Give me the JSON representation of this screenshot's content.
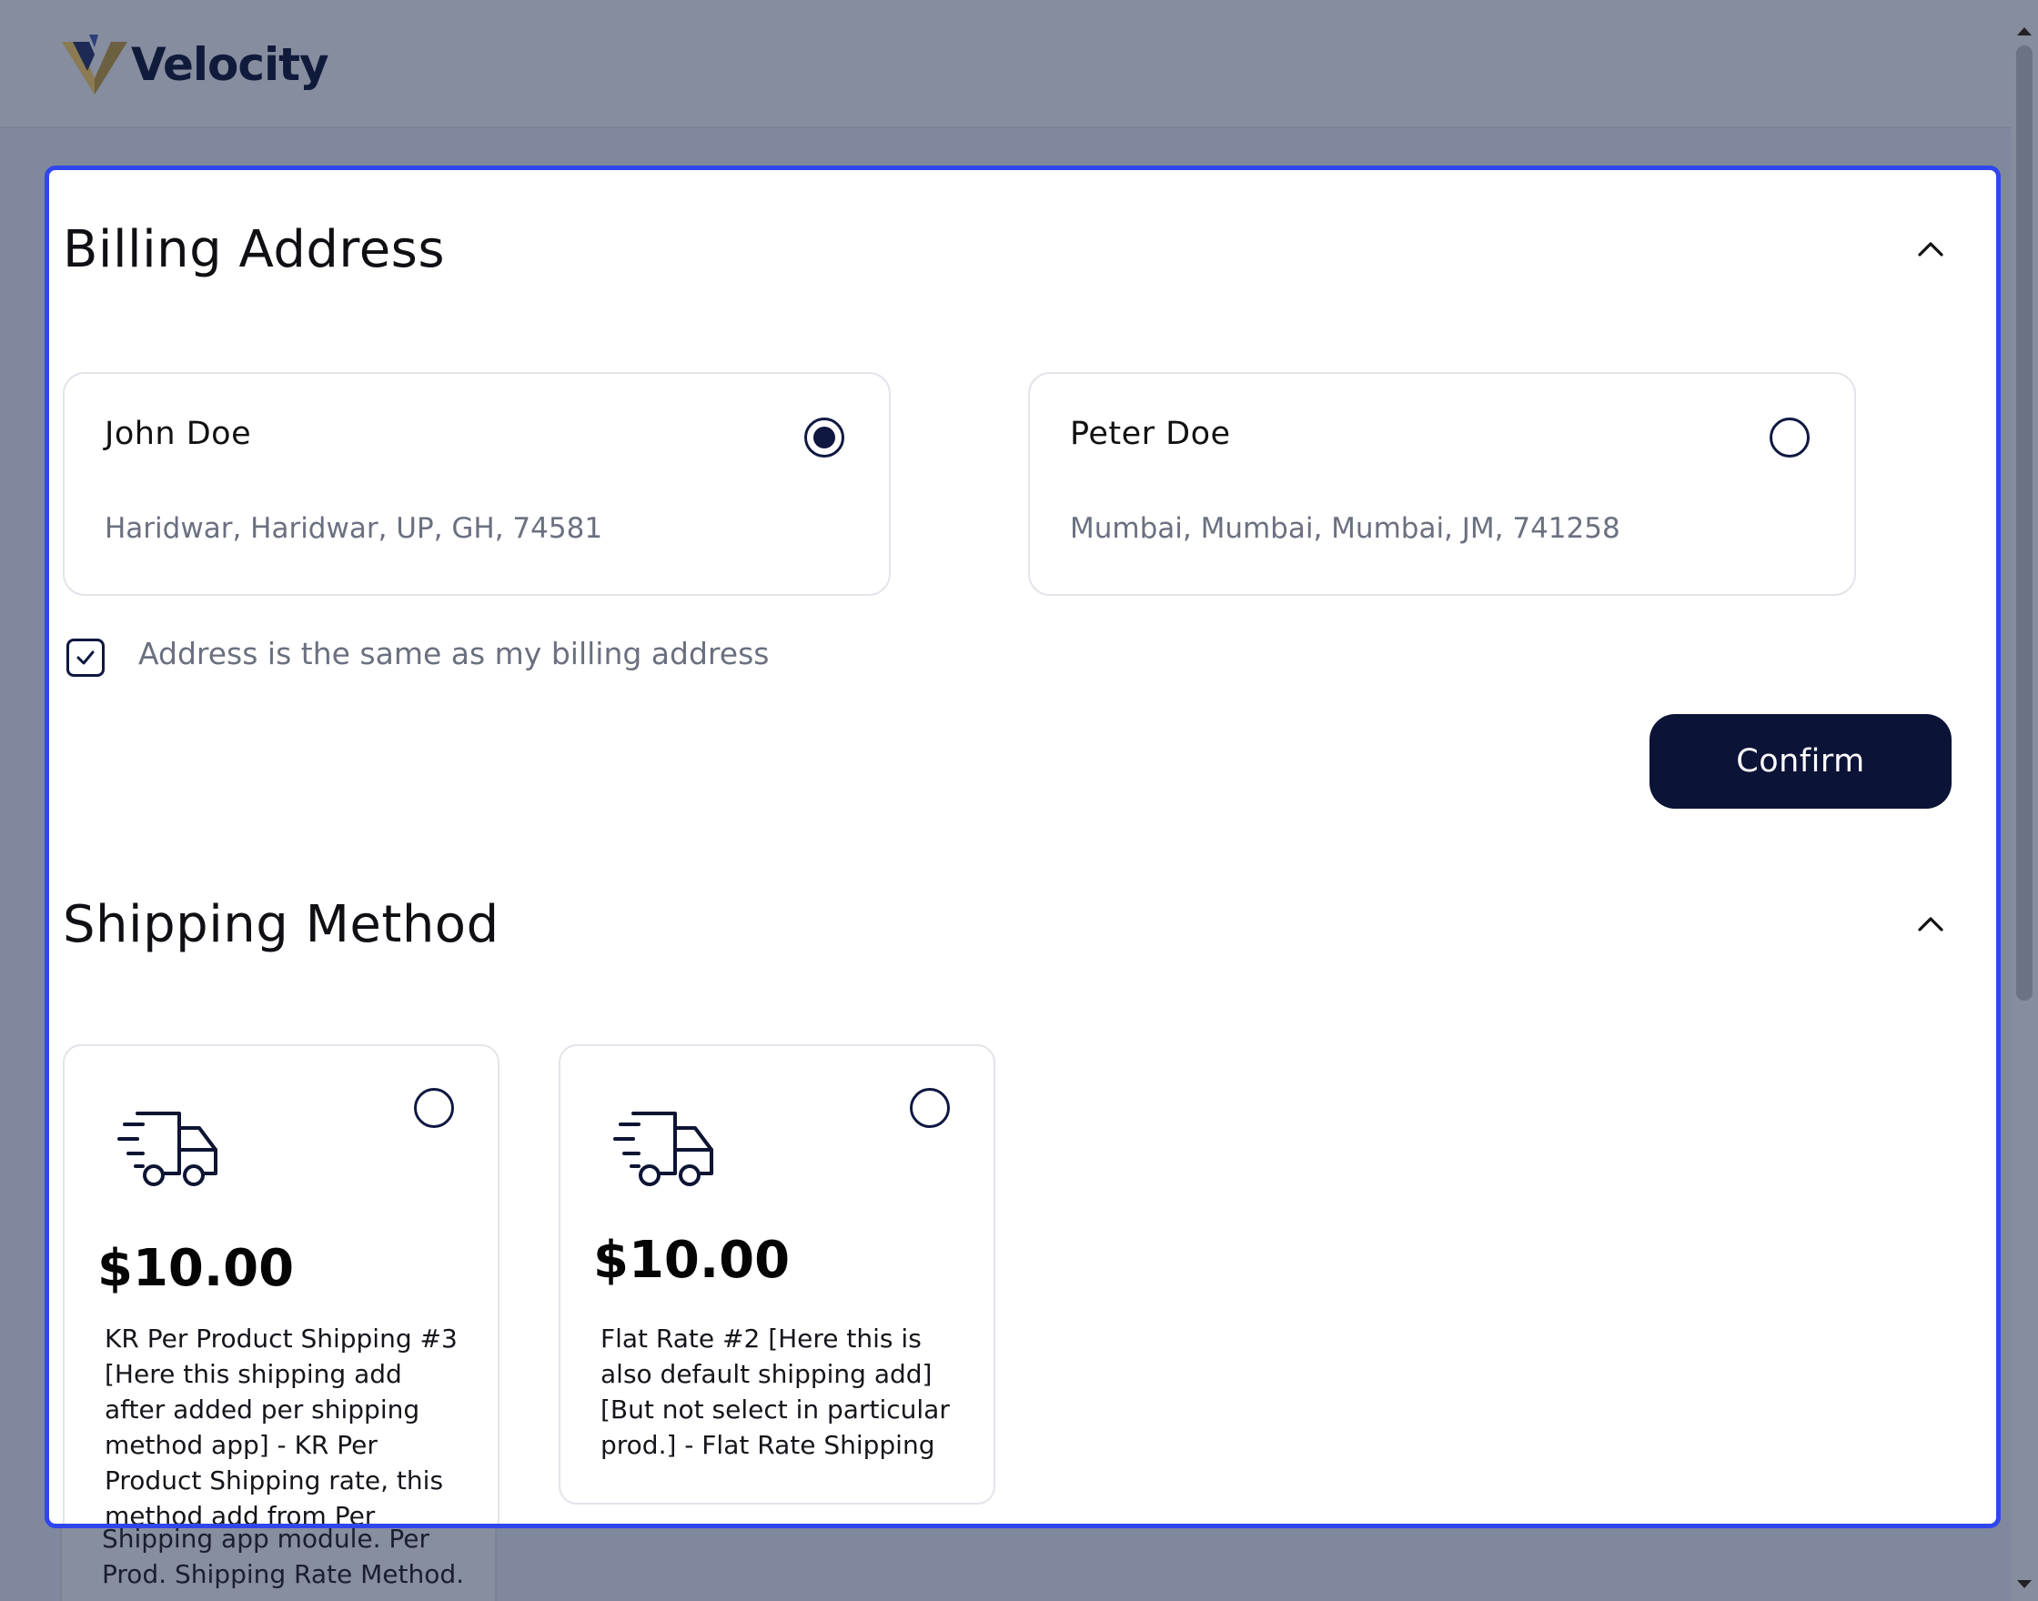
{
  "header": {
    "brand": "Velocity"
  },
  "billing": {
    "title": "Billing Address",
    "addresses": [
      {
        "name": "John Doe",
        "line": "Haridwar, Haridwar, UP, GH, 74581",
        "selected": true
      },
      {
        "name": "Peter Doe",
        "line": "Mumbai, Mumbai, Mumbai, JM, 741258",
        "selected": false
      }
    ],
    "same_address_label": "Address is the same as my billing address",
    "same_address_checked": true,
    "confirm_label": "Confirm"
  },
  "shipping": {
    "title": "Shipping Method",
    "methods": [
      {
        "price": "$10.00",
        "description": "KR Per Product Shipping #3 [Here this shipping add after added per shipping method app] - KR Per Product Shipping rate, this method add from Per Product Shipping app module. Per Prod. Shipping Rate Method.",
        "selected": false
      },
      {
        "price": "$10.00",
        "description": "Flat Rate #2 [Here this is also default shipping add] [But not select in particular prod.] - Flat Rate Shipping",
        "selected": false
      }
    ]
  },
  "colors": {
    "accent": "#2f46ee",
    "primary": "#0b1336",
    "overlay": "#7f889c"
  }
}
